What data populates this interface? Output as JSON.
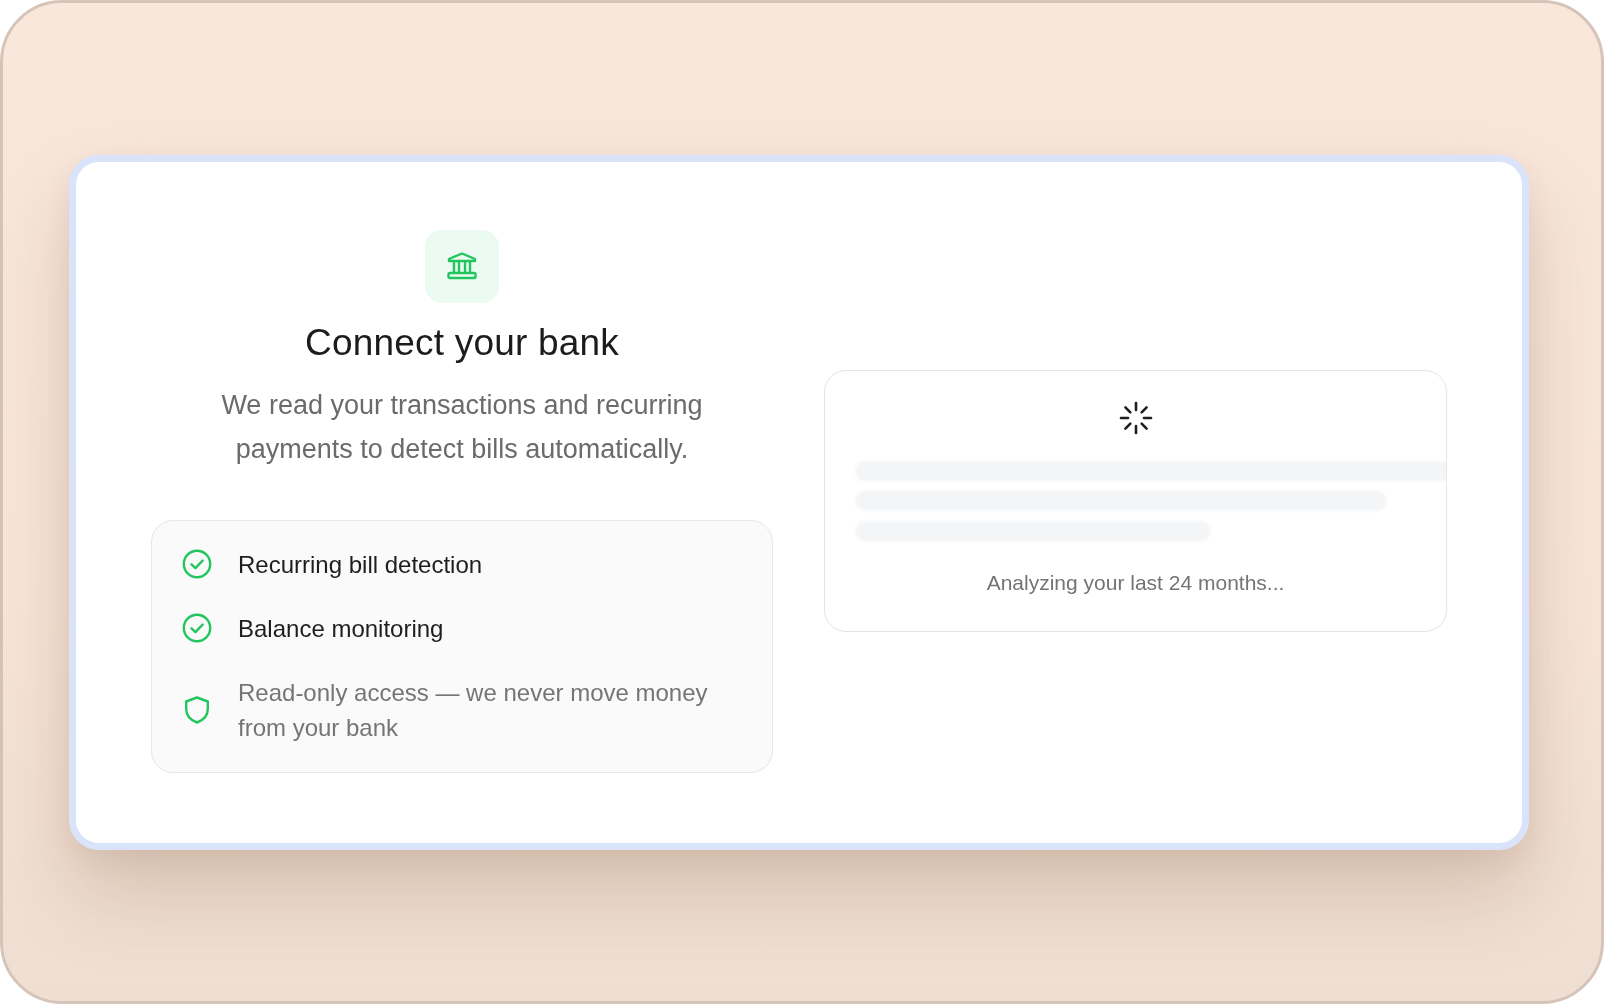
{
  "card": {
    "title": "Connect your bank",
    "description": "We read your transactions and recurring payments to detect bills automatically.",
    "features": [
      {
        "kind": "check",
        "label": "Recurring bill detection"
      },
      {
        "kind": "check",
        "label": "Balance monitoring"
      },
      {
        "kind": "shield",
        "label": "Read-only access — we never move money from your bank"
      }
    ],
    "loading": {
      "status": "Analyzing your last 24 months..."
    }
  }
}
